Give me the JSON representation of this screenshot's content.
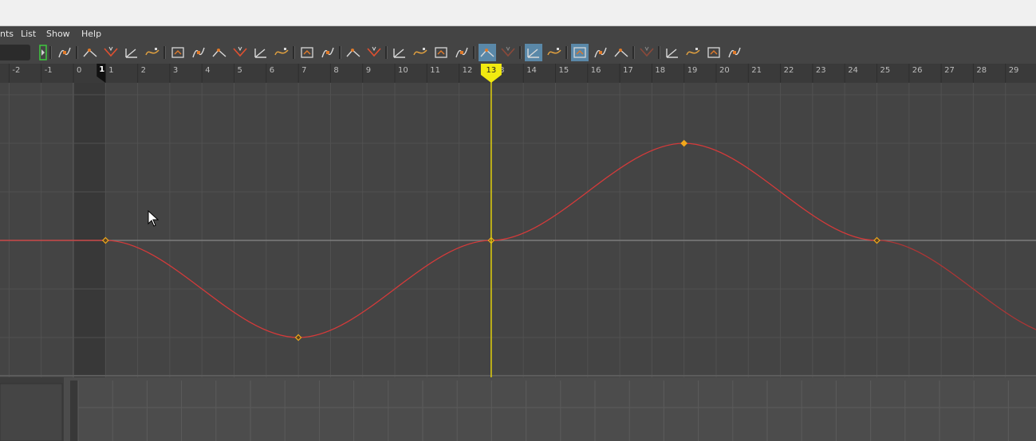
{
  "menu": [
    "nts",
    "List",
    "Show",
    "Help"
  ],
  "toolbar": {
    "buttons": [
      {
        "icon": "key-tangent-icon",
        "state": "normal"
      },
      {
        "icon": "tangent-in-icon",
        "state": "normal"
      },
      {
        "icon": "tangent-out-icon",
        "state": "normal"
      },
      {
        "icon": "tangent-mid-icon",
        "state": "normal"
      },
      {
        "icon": "tangent-c-icon",
        "state": "normal"
      },
      {
        "icon": "spline-tangent-icon",
        "state": "normal"
      },
      {
        "icon": "clamped-tangent-icon",
        "state": "normal"
      },
      {
        "icon": "linear-tangent-icon",
        "state": "normal"
      },
      {
        "icon": "flat-tangent-icon",
        "state": "normal"
      },
      {
        "icon": "step-tangent-icon",
        "state": "normal"
      },
      {
        "icon": "plateau-tangent-icon",
        "state": "normal"
      },
      {
        "icon": "in-tangent-icon",
        "state": "normal"
      },
      {
        "icon": "out-tangent-icon",
        "state": "normal"
      },
      {
        "icon": "break-tangents-icon",
        "state": "normal"
      },
      {
        "icon": "unify-tangents-icon",
        "state": "normal"
      },
      {
        "icon": "free-tangent-weight-icon",
        "state": "normal"
      },
      {
        "icon": "lock-tangent-weight-icon",
        "state": "normal"
      },
      {
        "icon": "weighted-tangents-icon",
        "state": "normal"
      },
      {
        "icon": "buffer-curve-icon",
        "state": "normal"
      },
      {
        "icon": "camera-view-icon",
        "state": "active"
      },
      {
        "icon": "swap-buffer-icon",
        "state": "dim"
      },
      {
        "icon": "magnet-snap-icon",
        "state": "active"
      },
      {
        "icon": "curve-snap-icon",
        "state": "normal"
      },
      {
        "icon": "absolute-view-icon",
        "state": "active"
      },
      {
        "icon": "stacked-view-icon",
        "state": "normal"
      },
      {
        "icon": "normalized-view-icon",
        "state": "normal"
      },
      {
        "icon": "pre-infinity-icon",
        "state": "dim"
      },
      {
        "icon": "cycle-icon",
        "state": "normal"
      },
      {
        "icon": "cycle-offset-icon",
        "state": "normal"
      },
      {
        "icon": "oscillate-icon",
        "state": "normal"
      },
      {
        "icon": "linear-infinity-icon",
        "state": "normal"
      }
    ]
  },
  "timeline": {
    "frame_labels": [
      "-2",
      "-1",
      "0",
      "1",
      "2",
      "3",
      "4",
      "5",
      "6",
      "7",
      "8",
      "9",
      "10",
      "11",
      "12",
      "13",
      "14",
      "15",
      "16",
      "17",
      "18",
      "19",
      "20",
      "21",
      "22",
      "23",
      "24",
      "25",
      "26",
      "27",
      "28",
      "29"
    ],
    "start_marker": "1",
    "current_frame": 13,
    "current_frame_label": "13"
  },
  "curve": {
    "color": "#d53a3a",
    "keys": [
      {
        "frame": 1,
        "value": 0,
        "selected": false
      },
      {
        "frame": 7,
        "value": -1,
        "selected": false
      },
      {
        "frame": 13,
        "value": 0,
        "selected": false
      },
      {
        "frame": 19,
        "value": 1,
        "selected": true
      },
      {
        "frame": 25,
        "value": 0,
        "selected": false
      }
    ],
    "post_infinity": "cycle"
  },
  "colors": {
    "graph_bg": "#444444",
    "range_shade": "#383838",
    "grid": "#515151",
    "zero_line": "#7c7c7c",
    "time_cursor": "#e3d20b",
    "key_fill": "#f2a81c",
    "accent": "#5a88a8"
  }
}
